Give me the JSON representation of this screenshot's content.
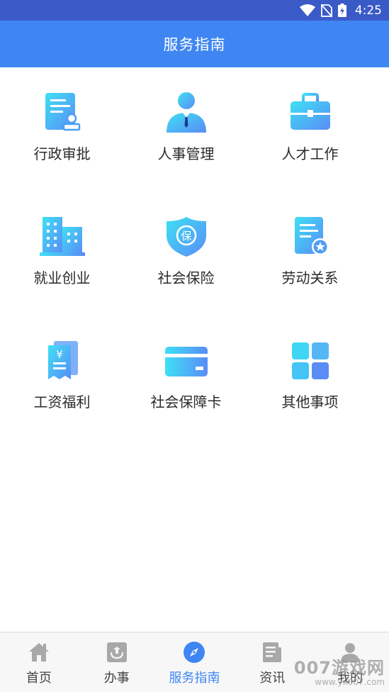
{
  "status_bar": {
    "time": "4:25"
  },
  "app_bar": {
    "title": "服务指南"
  },
  "grid": {
    "items": [
      {
        "label": "行政审批",
        "icon": "document-stamp-icon"
      },
      {
        "label": "人事管理",
        "icon": "person-tie-icon"
      },
      {
        "label": "人才工作",
        "icon": "briefcase-icon"
      },
      {
        "label": "就业创业",
        "icon": "buildings-icon"
      },
      {
        "label": "社会保险",
        "icon": "insurance-shield-icon"
      },
      {
        "label": "劳动关系",
        "icon": "certificate-icon"
      },
      {
        "label": "工资福利",
        "icon": "salary-receipt-icon"
      },
      {
        "label": "社会保障卡",
        "icon": "card-icon"
      },
      {
        "label": "其他事项",
        "icon": "grid-squares-icon"
      }
    ]
  },
  "tab_bar": {
    "tabs": [
      {
        "label": "首页",
        "icon": "home-icon",
        "active": false
      },
      {
        "label": "办事",
        "icon": "handle-affairs-icon",
        "active": false
      },
      {
        "label": "服务指南",
        "icon": "compass-icon",
        "active": true
      },
      {
        "label": "资讯",
        "icon": "news-icon",
        "active": false
      },
      {
        "label": "我的",
        "icon": "user-icon",
        "active": false
      }
    ]
  },
  "watermark": {
    "big": "007游戏网",
    "small": "www.yx007.com"
  },
  "colors": {
    "status_bar": "#3a5ac8",
    "app_bar": "#3f86f2",
    "icon_gradient_start": "#3ee0f4",
    "icon_gradient_end": "#5a8cf6",
    "tab_active": "#3f86f2",
    "tab_inactive": "#a8a8a8"
  }
}
